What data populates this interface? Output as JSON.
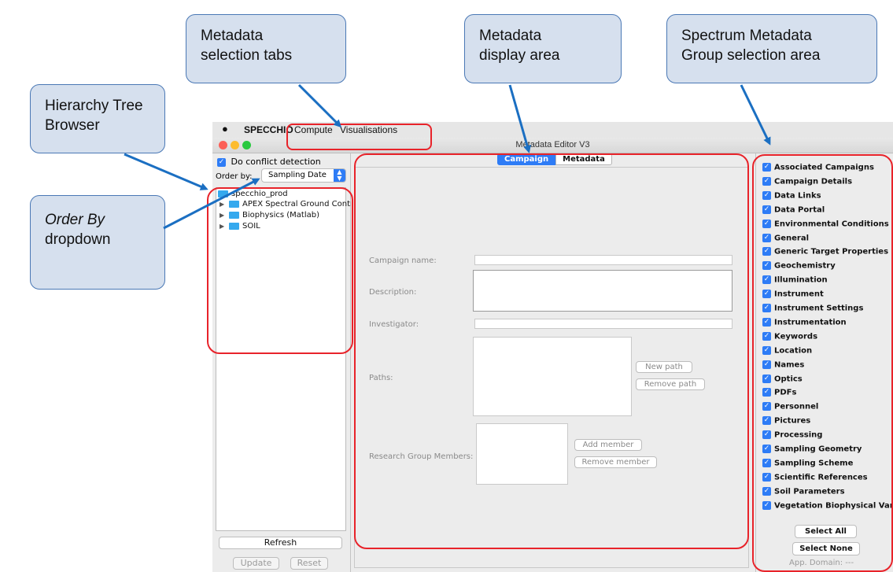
{
  "callouts": {
    "tabs": [
      "Metadata",
      "selection tabs"
    ],
    "display": [
      "Metadata",
      "display area"
    ],
    "group": [
      "Spectrum Metadata",
      "Group selection area"
    ],
    "tree": [
      "Hierarchy Tree",
      "Browser"
    ],
    "order_by": [
      "Order By",
      "dropdown"
    ]
  },
  "menubar": {
    "apple": "",
    "app": "SPECCHIO",
    "items": [
      "Compute",
      "Visualisations"
    ]
  },
  "window": {
    "title": "Metadata Editor V3"
  },
  "left": {
    "conflict_label": "Do conflict detection",
    "order_label": "Order by:",
    "order_value": "Sampling Date",
    "tree": {
      "root": "specchio_prod",
      "children": [
        "APEX Spectral Ground Control",
        "Biophysics (Matlab)",
        "SOIL"
      ]
    },
    "refresh": "Refresh",
    "update": "Update",
    "reset": "Reset"
  },
  "center": {
    "tabs": [
      "Campaign",
      "Metadata"
    ],
    "campaign_name_label": "Campaign name:",
    "description_label": "Description:",
    "investigator_label": "Investigator:",
    "paths_label": "Paths:",
    "new_path": "New path",
    "remove_path": "Remove path",
    "members_label": "Research Group Members:",
    "add_member": "Add member",
    "remove_member": "Remove member"
  },
  "right": {
    "groups": [
      "Associated Campaigns",
      "Campaign Details",
      "Data Links",
      "Data Portal",
      "Environmental Conditions",
      "General",
      "Generic Target Properties",
      "Geochemistry",
      "Illumination",
      "Instrument",
      "Instrument Settings",
      "Instrumentation",
      "Keywords",
      "Location",
      "Names",
      "Optics",
      "PDFs",
      "Personnel",
      "Pictures",
      "Processing",
      "Sampling Geometry",
      "Sampling Scheme",
      "Scientific References",
      "Soil Parameters",
      "Vegetation Biophysical Variables"
    ],
    "select_all": "Select All",
    "select_none": "Select None",
    "app_domain": "App. Domain: ---"
  },
  "colors": {
    "accent": "#2e7cf6",
    "highlight": "#e8232a",
    "callout_fill": "#d6e0ee",
    "callout_border": "#4a78b5",
    "arrow": "#1b6fc2"
  }
}
